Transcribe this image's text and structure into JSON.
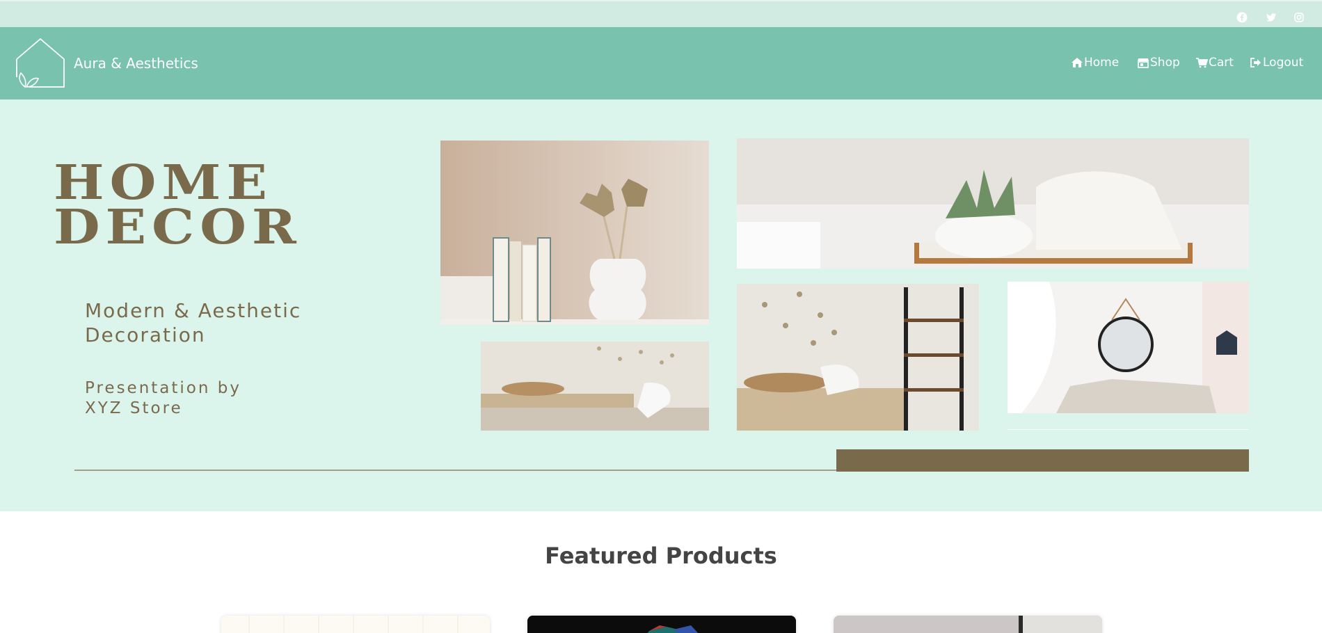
{
  "brand": {
    "name": "Aura & Aesthetics"
  },
  "social": [
    {
      "icon": "facebook-icon"
    },
    {
      "icon": "twitter-icon"
    },
    {
      "icon": "instagram-icon"
    }
  ],
  "nav": {
    "home": "Home",
    "shop": "Shop",
    "cart": "Cart",
    "logout": "Logout"
  },
  "hero": {
    "title_line1": "HOME",
    "title_line2": "DECOR",
    "subtitle_line1": "Modern & Aesthetic",
    "subtitle_line2": "Decoration",
    "presenter_line1": "Presentation by",
    "presenter_line2": "XYZ Store"
  },
  "featured": {
    "heading": "Featured Products"
  },
  "colors": {
    "topbar": "#d2ebe2",
    "navbar": "#78c2ae",
    "hero_bg": "#dcf5ec",
    "accent_brown": "#7a6a4c"
  }
}
